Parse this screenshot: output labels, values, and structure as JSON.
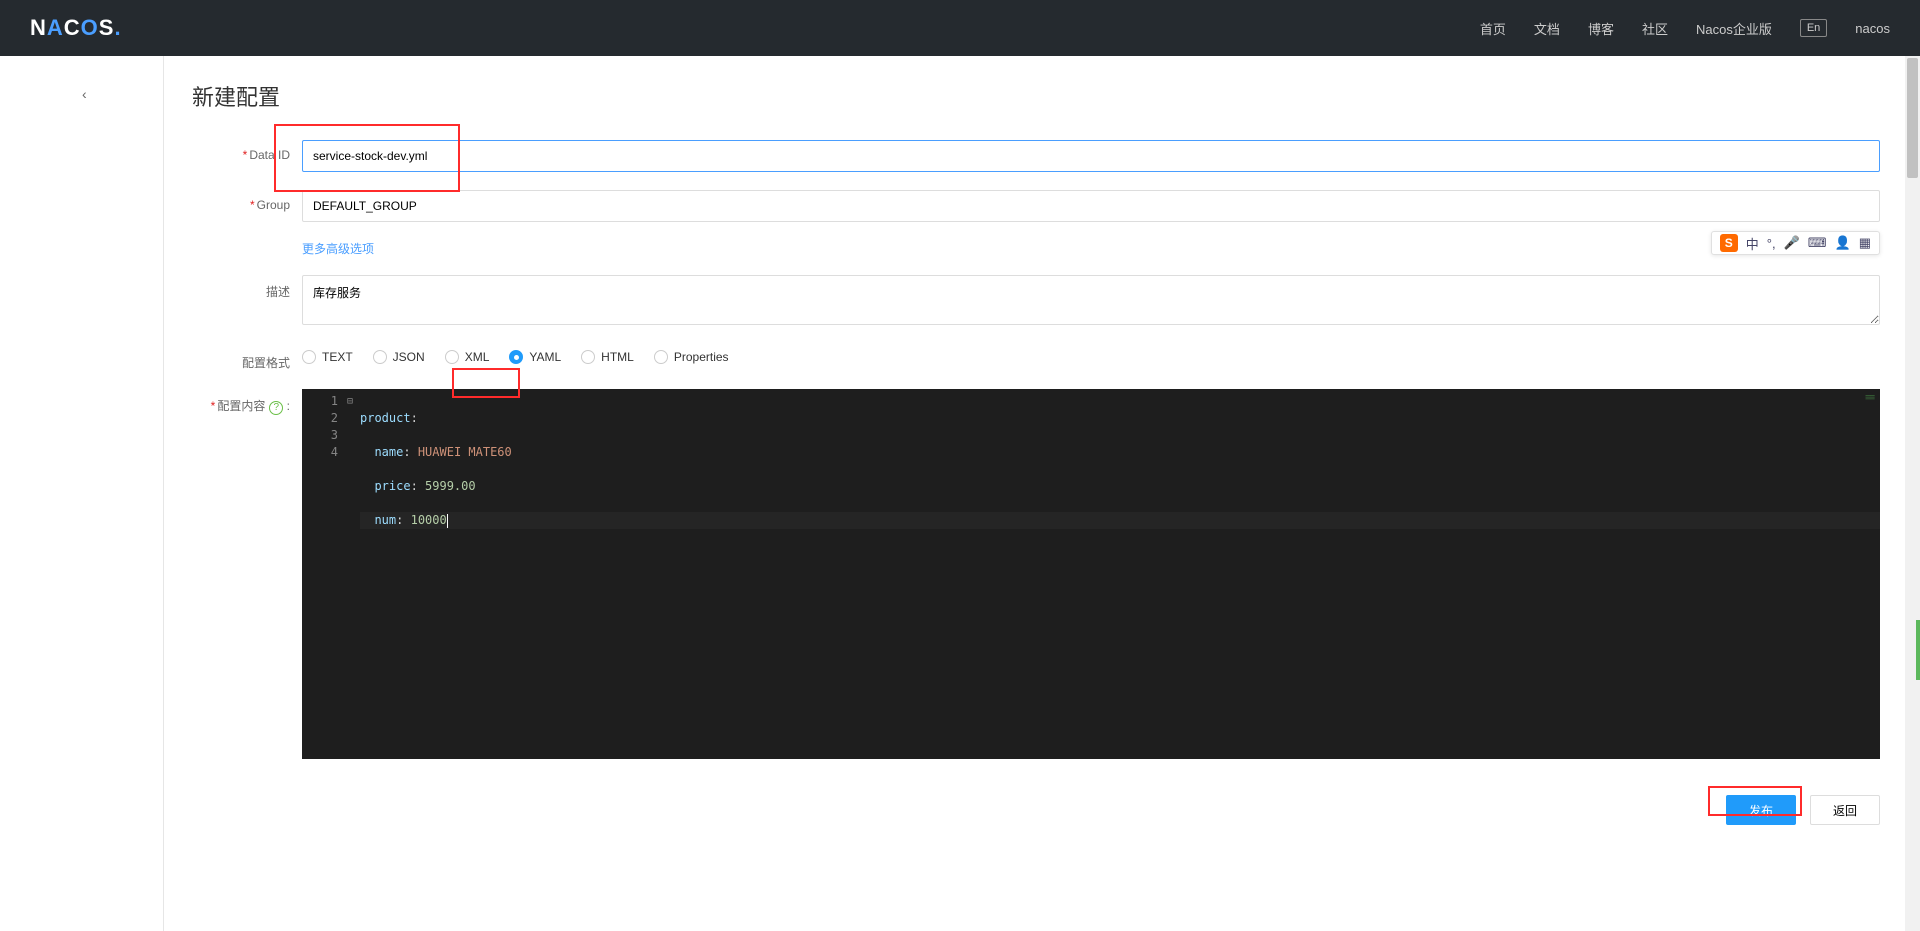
{
  "header": {
    "logo_prefix": "N",
    "logo_a": "A",
    "logo_mid": "C",
    "logo_o": "O",
    "logo_suffix": "S",
    "nav": {
      "home": "首页",
      "docs": "文档",
      "blog": "博客",
      "community": "社区",
      "enterprise": "Nacos企业版",
      "lang": "En",
      "user": "nacos"
    }
  },
  "page": {
    "title": "新建配置"
  },
  "form": {
    "labels": {
      "data_id": "Data ID",
      "group": "Group",
      "more": "更多高级选项",
      "description": "描述",
      "format": "配置格式",
      "content": "配置内容"
    },
    "values": {
      "data_id": "service-stock-dev.yml",
      "group": "DEFAULT_GROUP",
      "description": "库存服务"
    },
    "formats": {
      "text": "TEXT",
      "json": "JSON",
      "xml": "XML",
      "yaml": "YAML",
      "html": "HTML",
      "properties": "Properties"
    }
  },
  "editor": {
    "lines": [
      "1",
      "2",
      "3",
      "4"
    ],
    "code": {
      "l1_key": "product",
      "l2_key": "name",
      "l2_val": " HUAWEI MATE60",
      "l3_key": "price",
      "l3_val": " 5999.00",
      "l4_key": "num",
      "l4_val": " 10000"
    }
  },
  "actions": {
    "publish": "发布",
    "back": "返回"
  },
  "ime": {
    "lang": "中"
  }
}
